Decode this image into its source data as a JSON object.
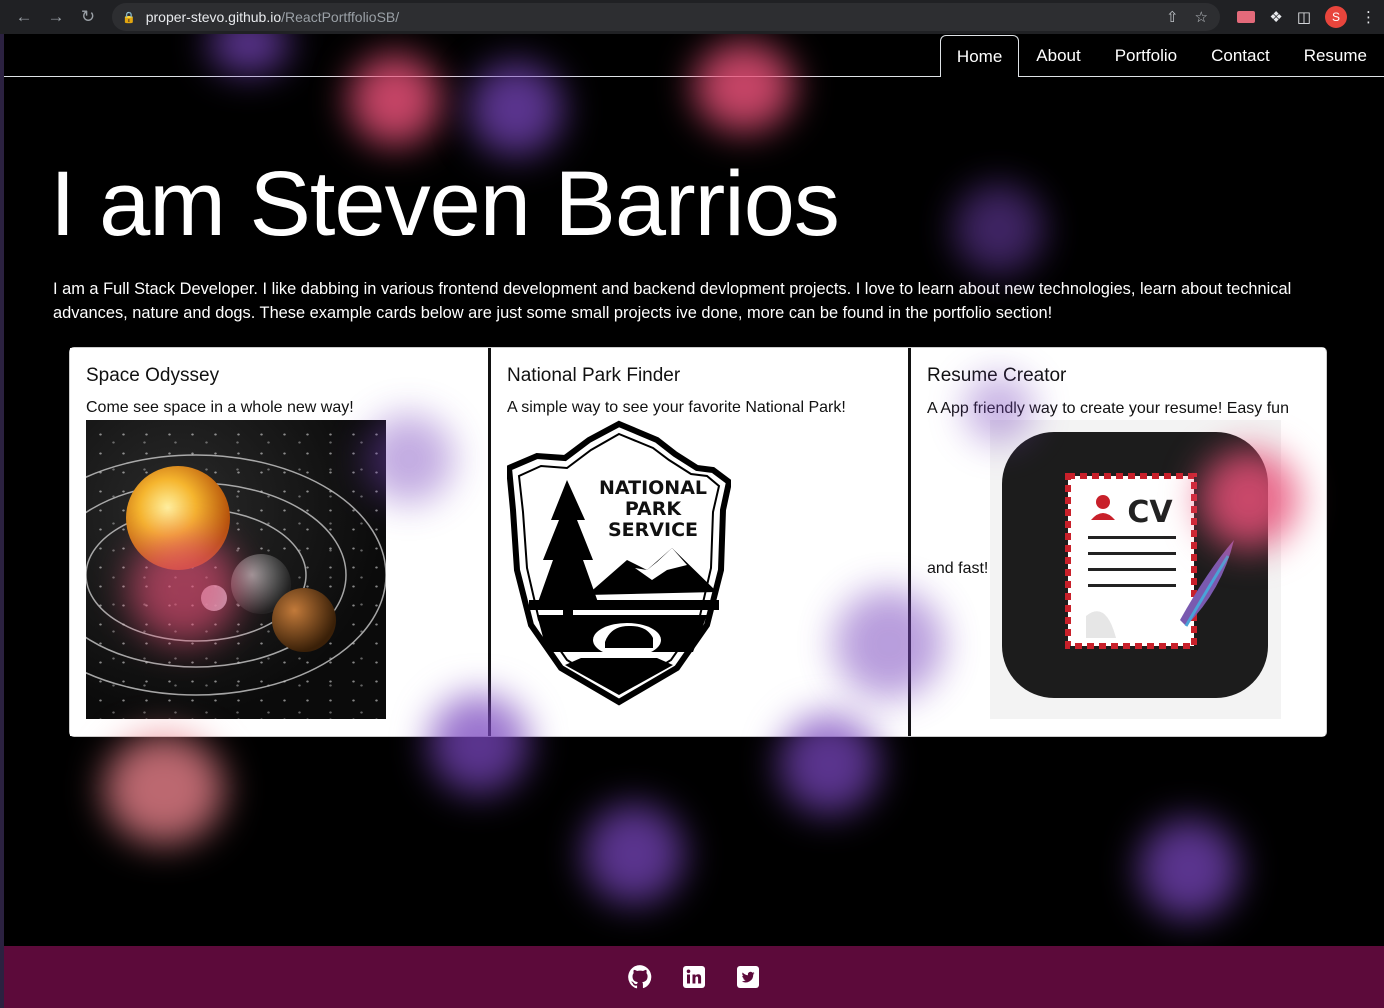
{
  "browser": {
    "url_host": "proper-stevo.github.io",
    "url_path": "/ReactPortffolioSB/",
    "profile_initial": "S"
  },
  "nav": {
    "items": [
      {
        "label": "Home",
        "active": true
      },
      {
        "label": "About",
        "active": false
      },
      {
        "label": "Portfolio",
        "active": false
      },
      {
        "label": "Contact",
        "active": false
      },
      {
        "label": "Resume",
        "active": false
      }
    ]
  },
  "hero": {
    "title": "I am Steven Barrios",
    "intro": "I am a Full Stack Developer. I like dabbing in various frontend development and backend devlopment projects. I love to learn about new technologies, learn about technical advances, nature and dogs. These example cards below are just some small projects ive done, more can be found in the portfolio section!"
  },
  "cards": [
    {
      "title": "Space Odyssey",
      "text": "Come see space in a whole new way!",
      "image": "solar-system-image"
    },
    {
      "title": "National Park Finder",
      "text": "A simple way to see your favorite National Park!",
      "image": "national-park-service-logo",
      "logo_lines": [
        "NATIONAL",
        "PARK",
        "SERVICE"
      ]
    },
    {
      "title": "Resume Creator",
      "text": "A App friendly way to create your resume! Easy fun",
      "text_after": "and fast!",
      "image": "cv-app-icon",
      "image_text": "CV"
    }
  ],
  "footer": {
    "icons": [
      "github-icon",
      "linkedin-icon",
      "twitter-icon"
    ]
  },
  "colors": {
    "background": "#000000",
    "footer": "#5c0a3a",
    "blob_pink": "#e85078",
    "blob_purple": "#7846be"
  }
}
